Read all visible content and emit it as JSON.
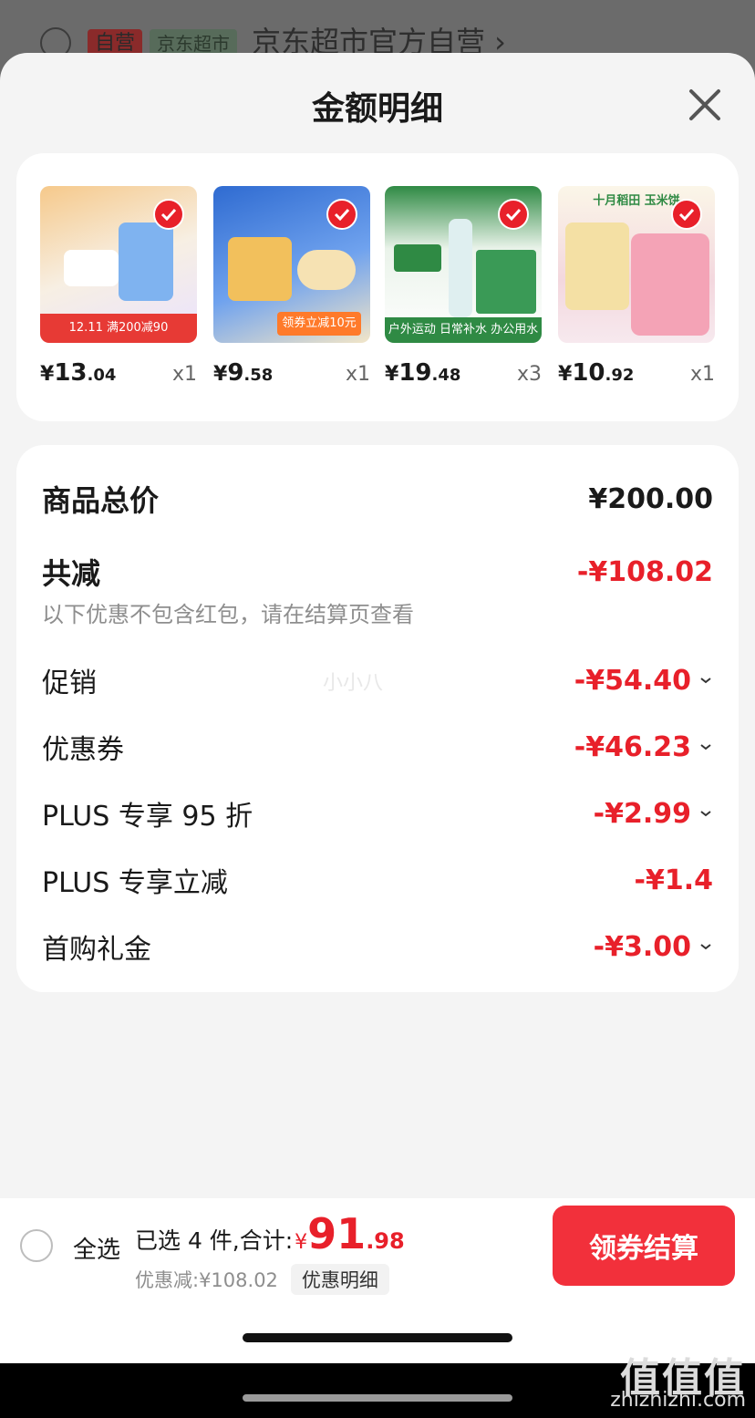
{
  "background": {
    "self_badge": "自营",
    "store_tag": "京东超市",
    "shop_name": "京东超市官方自营 ›"
  },
  "sheet": {
    "title": "金额明细"
  },
  "products": [
    {
      "currency": "¥",
      "price_int": "13",
      "price_dec": ".04",
      "qty": "x1",
      "img_colors": [
        "#f0d9c0",
        "#f6efe4"
      ],
      "banner": "12.11  满200减90"
    },
    {
      "currency": "¥",
      "price_int": "9",
      "price_dec": ".58",
      "qty": "x1",
      "img_colors": [
        "#3c7ad6",
        "#f4f4f4"
      ],
      "banner": "领券立减10元"
    },
    {
      "currency": "¥",
      "price_int": "19",
      "price_dec": ".48",
      "qty": "x3",
      "img_colors": [
        "#2f8a44",
        "#eaf3ea"
      ],
      "banner": "户外运动 日常补水 办公用水"
    },
    {
      "currency": "¥",
      "price_int": "10",
      "price_dec": ".92",
      "qty": "x1",
      "img_colors": [
        "#f3d7de",
        "#fbeef0"
      ],
      "banner": "十月稻田 玉米饼"
    }
  ],
  "summary": {
    "total_label": "商品总价",
    "total_value": "¥200.00",
    "reduce_label": "共减",
    "reduce_value": "-¥108.02",
    "note": "以下优惠不包含红包，请在结算页查看",
    "items": [
      {
        "label": "促销",
        "value": "-¥54.40"
      },
      {
        "label": "优惠券",
        "value": "-¥46.23"
      },
      {
        "label": "PLUS 专享 95 折",
        "value": "-¥2.99"
      },
      {
        "label": "PLUS 专享立减",
        "value": "-¥1.4"
      },
      {
        "label": "首购礼金",
        "value": "-¥3.00"
      }
    ]
  },
  "bottom": {
    "select_all": "全选",
    "selected_text": "已选 4 件,合计:",
    "currency": "¥",
    "total_int": "91",
    "total_dec": ".98",
    "discount_text": "优惠减:¥108.02",
    "detail_button": "优惠明细",
    "checkout_button": "领券结算"
  },
  "watermark": {
    "logo": "值值值",
    "url": "zhizhizhi.com",
    "center": "小小八"
  },
  "colors": {
    "accent_red": "#e8202a",
    "checkout_red": "#f2303b"
  }
}
